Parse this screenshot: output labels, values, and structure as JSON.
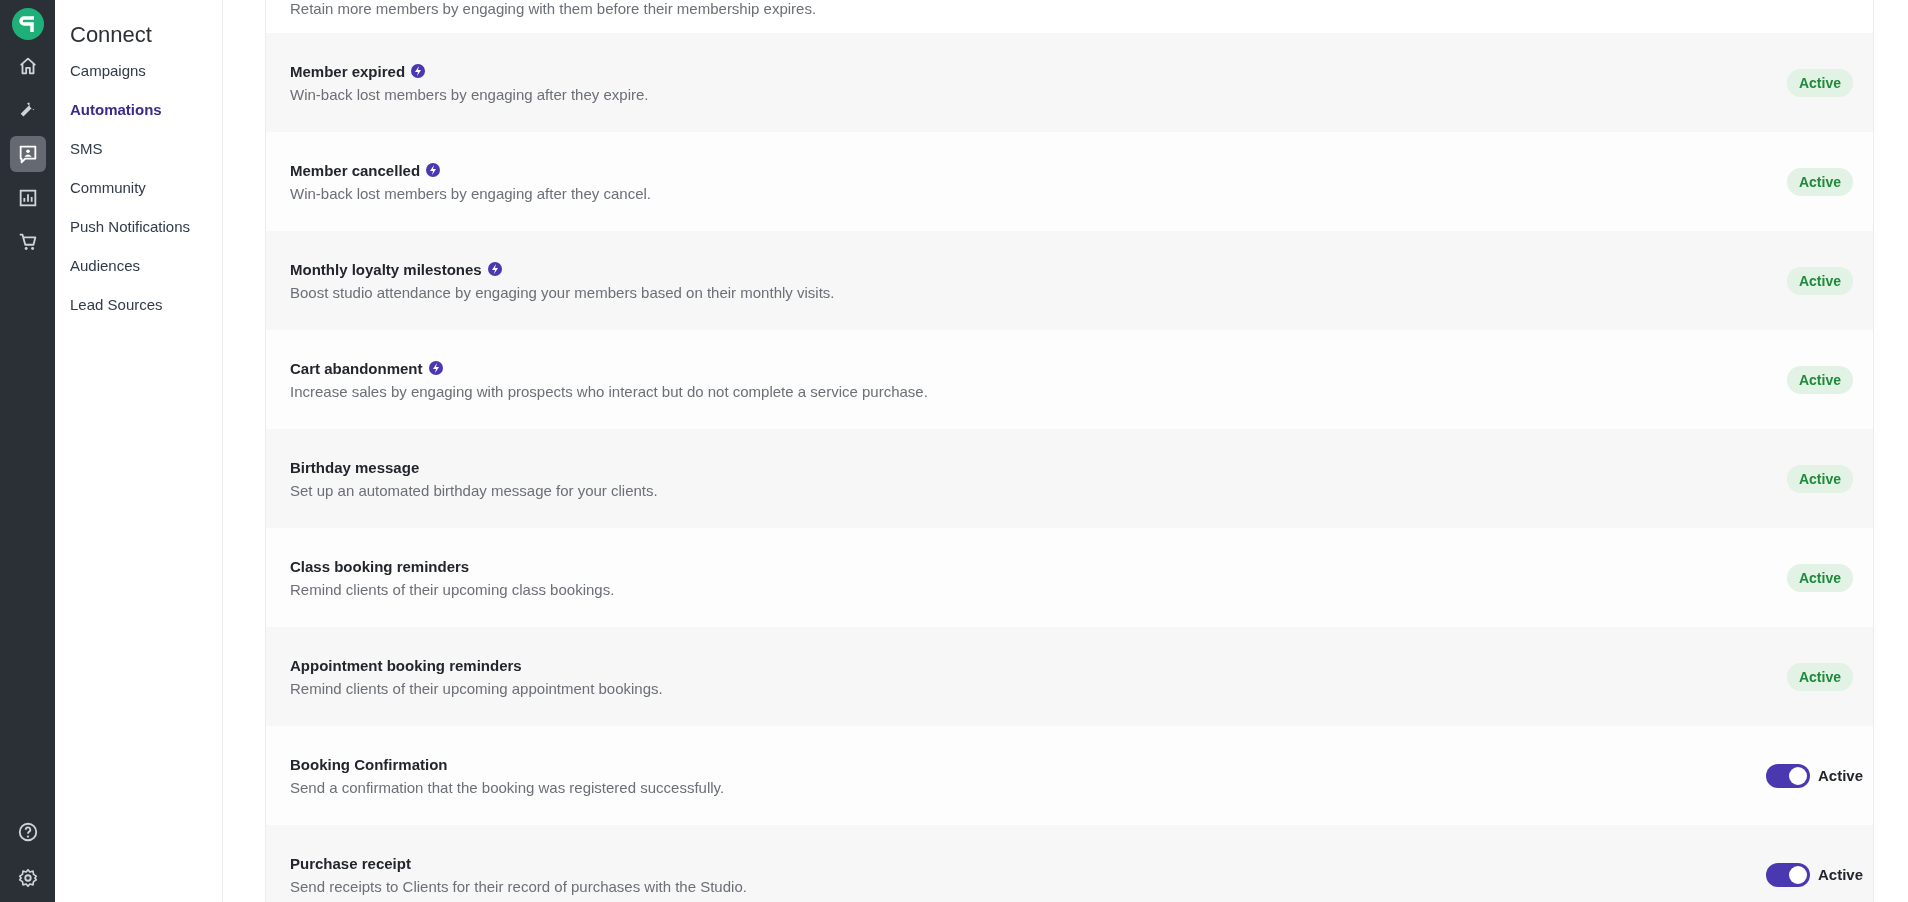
{
  "rail": {
    "items": [
      {
        "selected": false
      },
      {
        "selected": false
      },
      {
        "selected": true
      },
      {
        "selected": false
      },
      {
        "selected": false
      }
    ]
  },
  "sidebar": {
    "title": "Connect",
    "items": [
      {
        "label": "Campaigns",
        "selected": false
      },
      {
        "label": "Automations",
        "selected": true
      },
      {
        "label": "SMS",
        "selected": false
      },
      {
        "label": "Community",
        "selected": false
      },
      {
        "label": "Push Notifications",
        "selected": false
      },
      {
        "label": "Audiences",
        "selected": false
      },
      {
        "label": "Lead Sources",
        "selected": false
      }
    ]
  },
  "partial_description": "Retain more members by engaging with them before their membership expires.",
  "automations": [
    {
      "title": "Member expired",
      "premium": true,
      "description": "Win-back lost members by engaging after they expire.",
      "kind": "badge",
      "status": "Active"
    },
    {
      "title": "Member cancelled",
      "premium": true,
      "description": "Win-back lost members by engaging after they cancel.",
      "kind": "badge",
      "status": "Active"
    },
    {
      "title": "Monthly loyalty milestones",
      "premium": true,
      "description": "Boost studio attendance by engaging your members based on their monthly visits.",
      "kind": "badge",
      "status": "Active"
    },
    {
      "title": "Cart abandonment",
      "premium": true,
      "description": "Increase sales by engaging with prospects who interact but do not complete a service purchase.",
      "kind": "badge",
      "status": "Active"
    },
    {
      "title": "Birthday message",
      "premium": false,
      "description": "Set up an automated birthday message for your clients.",
      "kind": "badge",
      "status": "Active"
    },
    {
      "title": "Class booking reminders",
      "premium": false,
      "description": "Remind clients of their upcoming class bookings.",
      "kind": "badge",
      "status": "Active"
    },
    {
      "title": "Appointment booking reminders",
      "premium": false,
      "description": "Remind clients of their upcoming appointment bookings.",
      "kind": "badge",
      "status": "Active"
    },
    {
      "title": "Booking Confirmation",
      "premium": false,
      "description": "Send a confirmation that the booking was registered successfully.",
      "kind": "toggle",
      "on": true,
      "status": "Active"
    },
    {
      "title": "Purchase receipt",
      "premium": false,
      "description": "Send receipts to Clients for their record of purchases with the Studio.",
      "kind": "toggle",
      "on": true,
      "status": "Active"
    }
  ]
}
